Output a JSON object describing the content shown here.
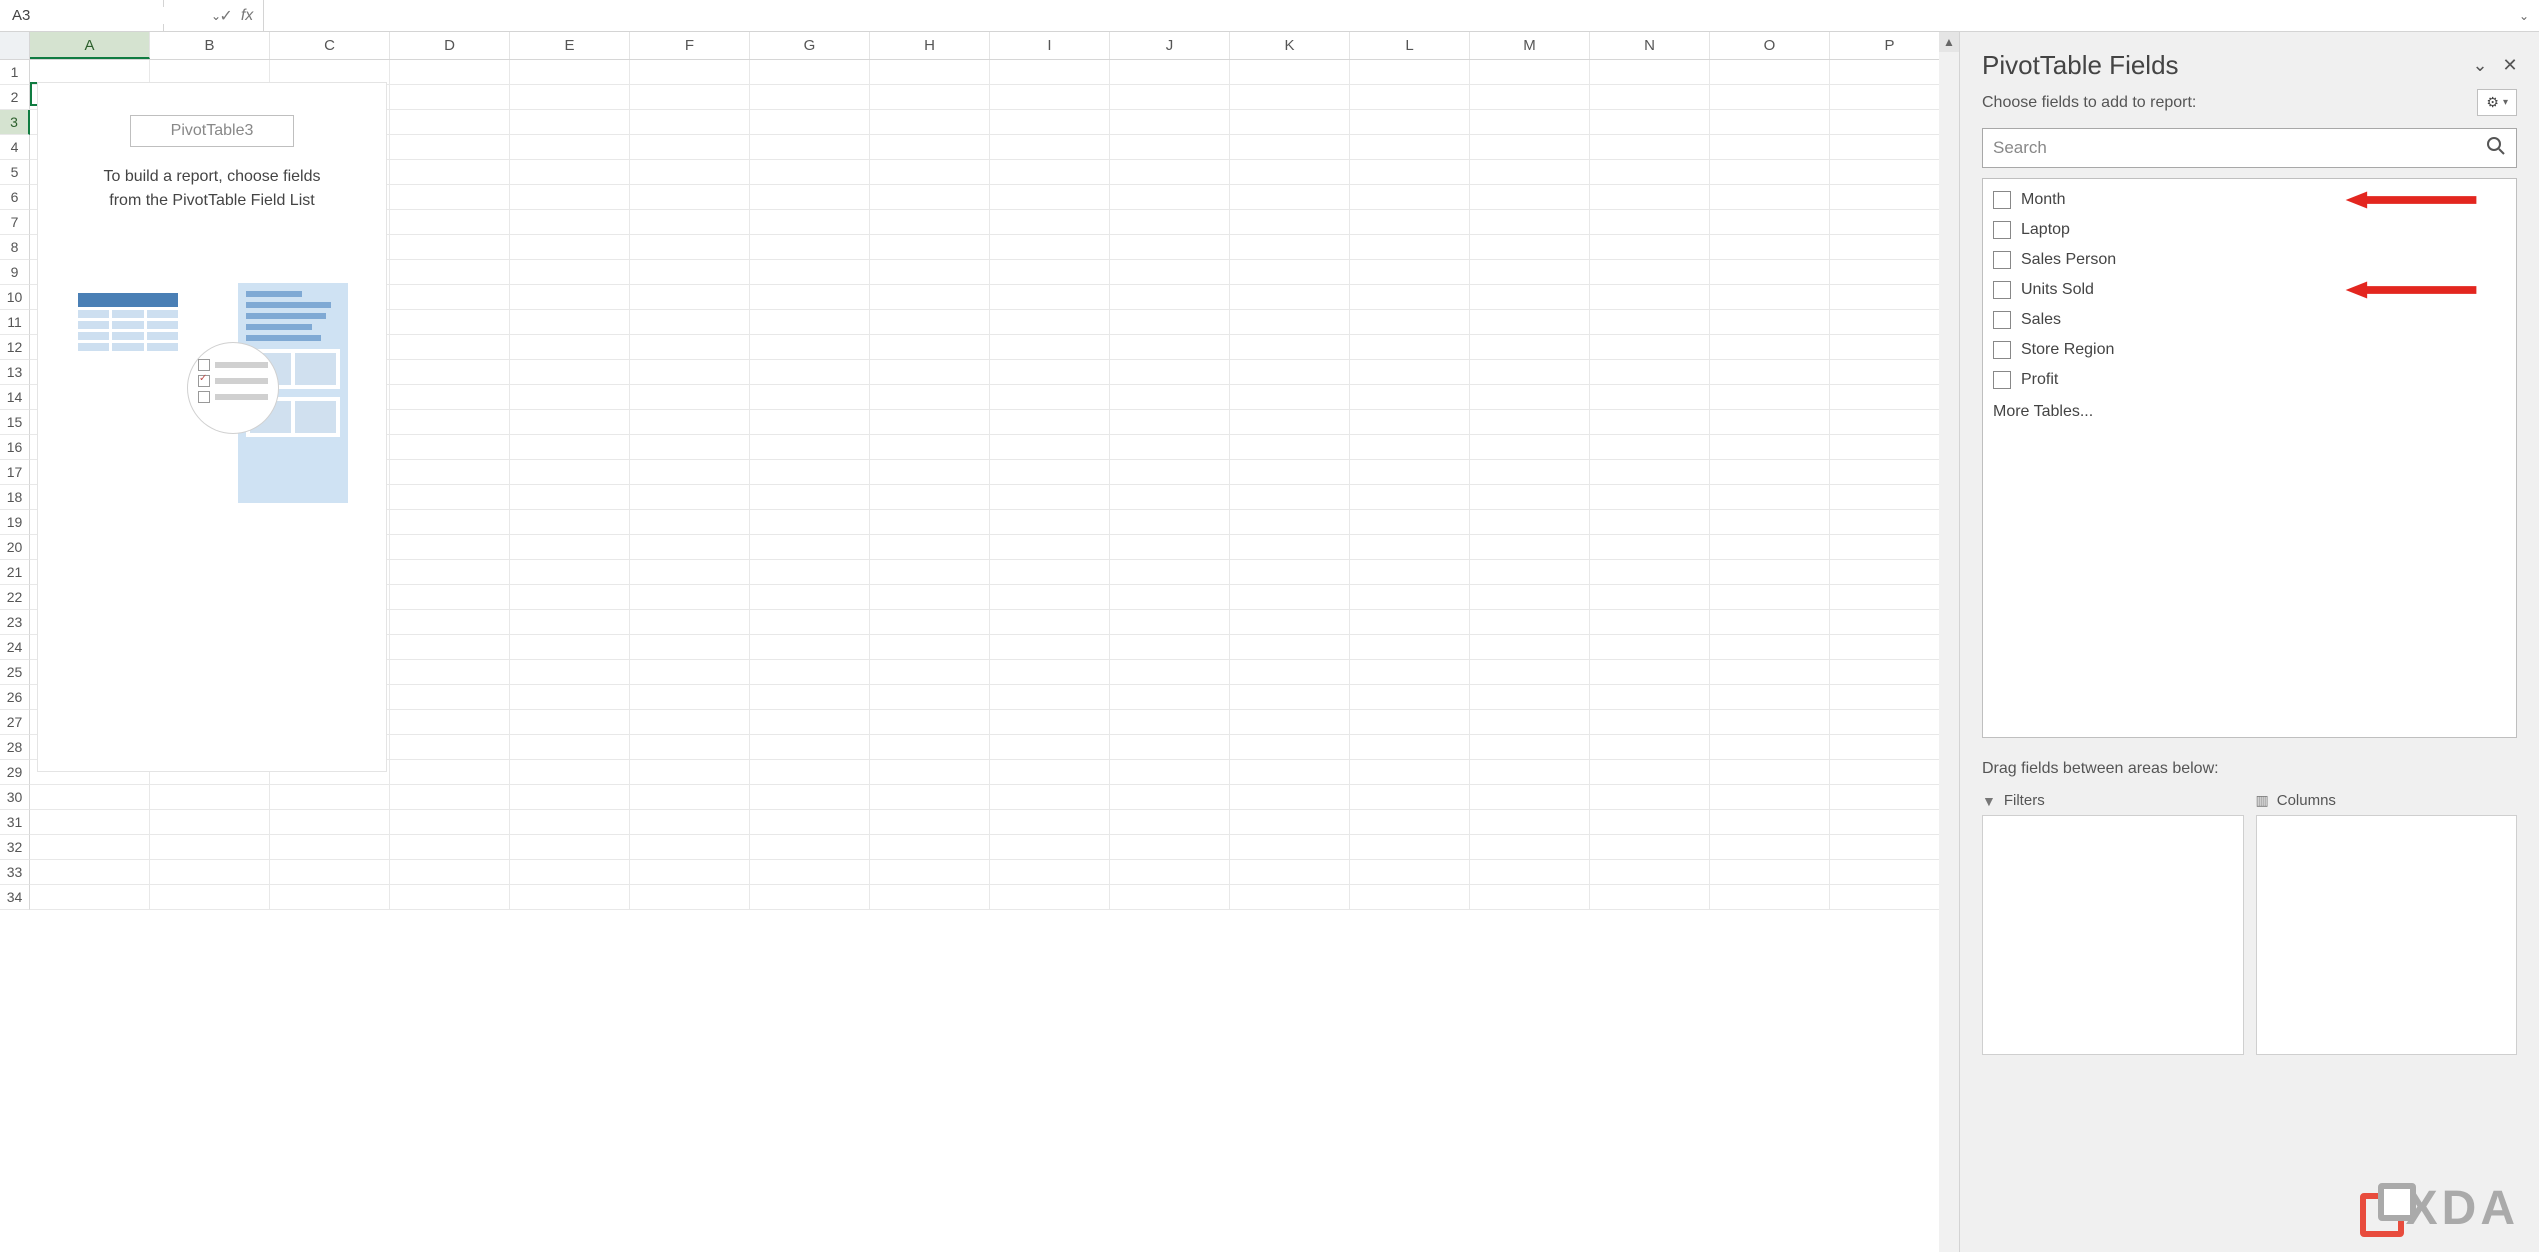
{
  "formula_bar": {
    "name_box_value": "A3",
    "fx_label": "fx",
    "cancel_glyph": "✕",
    "accept_glyph": "✓",
    "more_glyph": "⋮",
    "expand_glyph": "⌄"
  },
  "grid": {
    "columns": [
      "A",
      "B",
      "C",
      "D",
      "E",
      "F",
      "G",
      "H",
      "I",
      "J",
      "K",
      "L",
      "M",
      "N",
      "O",
      "P"
    ],
    "row_count": 34,
    "selected_column": "A",
    "selected_row": 3
  },
  "pivot_placeholder": {
    "title": "PivotTable3",
    "text_line1": "To build a report, choose fields",
    "text_line2": "from the PivotTable Field List"
  },
  "panel": {
    "title": "PivotTable Fields",
    "subtitle": "Choose fields to add to report:",
    "search_placeholder": "Search",
    "more_tables": "More Tables...",
    "drag_label": "Drag fields between areas below:",
    "area_filters": "Filters",
    "area_columns": "Columns",
    "fields": [
      {
        "label": "Month",
        "arrow": true
      },
      {
        "label": "Laptop",
        "arrow": false
      },
      {
        "label": "Sales Person",
        "arrow": false
      },
      {
        "label": "Units Sold",
        "arrow": true
      },
      {
        "label": "Sales",
        "arrow": false
      },
      {
        "label": "Store Region",
        "arrow": false
      },
      {
        "label": "Profit",
        "arrow": false
      }
    ]
  },
  "watermark": {
    "text": "XDA"
  }
}
